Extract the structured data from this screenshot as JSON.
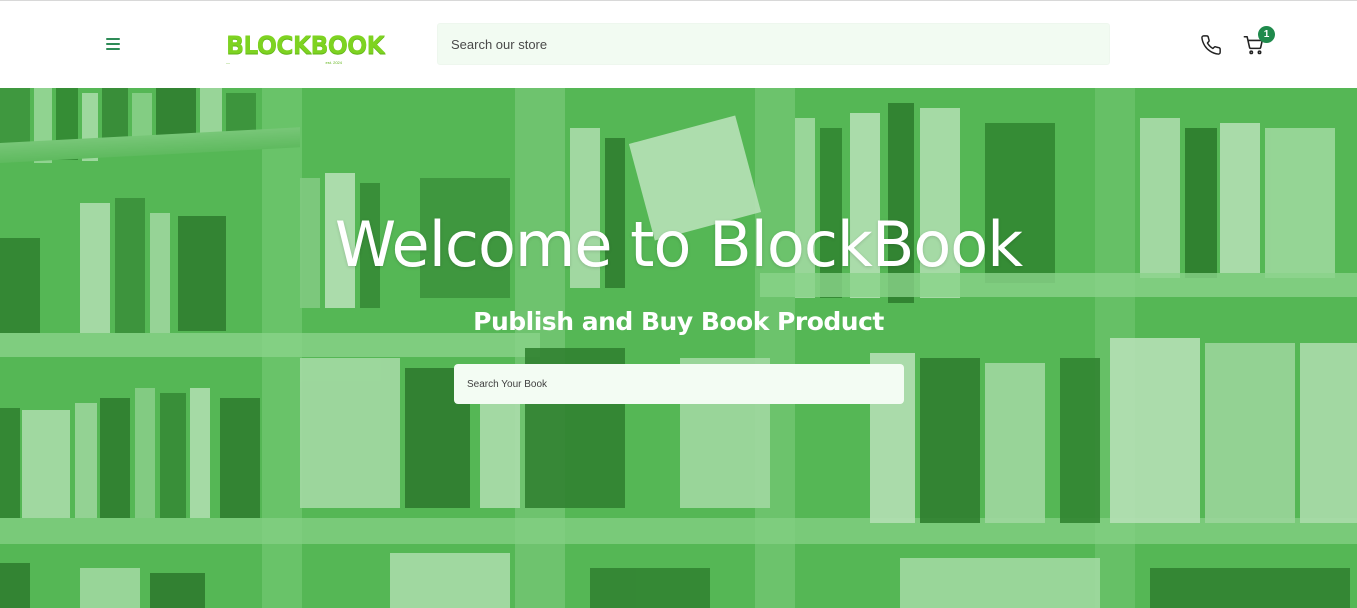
{
  "header": {
    "logo_text": "BLOCKBOOK",
    "logo_sub_left": "—",
    "logo_sub_right": "est. 2024",
    "search_placeholder": "Search our store",
    "cart_count": "1"
  },
  "hero": {
    "title": "Welcome to BlockBook",
    "subtitle": "Publish and Buy Book Product",
    "search_placeholder": "Search Your Book"
  },
  "colors": {
    "brand_green": "#7ed321",
    "accent_green": "#1f8a4c",
    "hero_tint": "#5dbb5d"
  },
  "icons": [
    "menu-icon",
    "phone-icon",
    "cart-icon"
  ]
}
